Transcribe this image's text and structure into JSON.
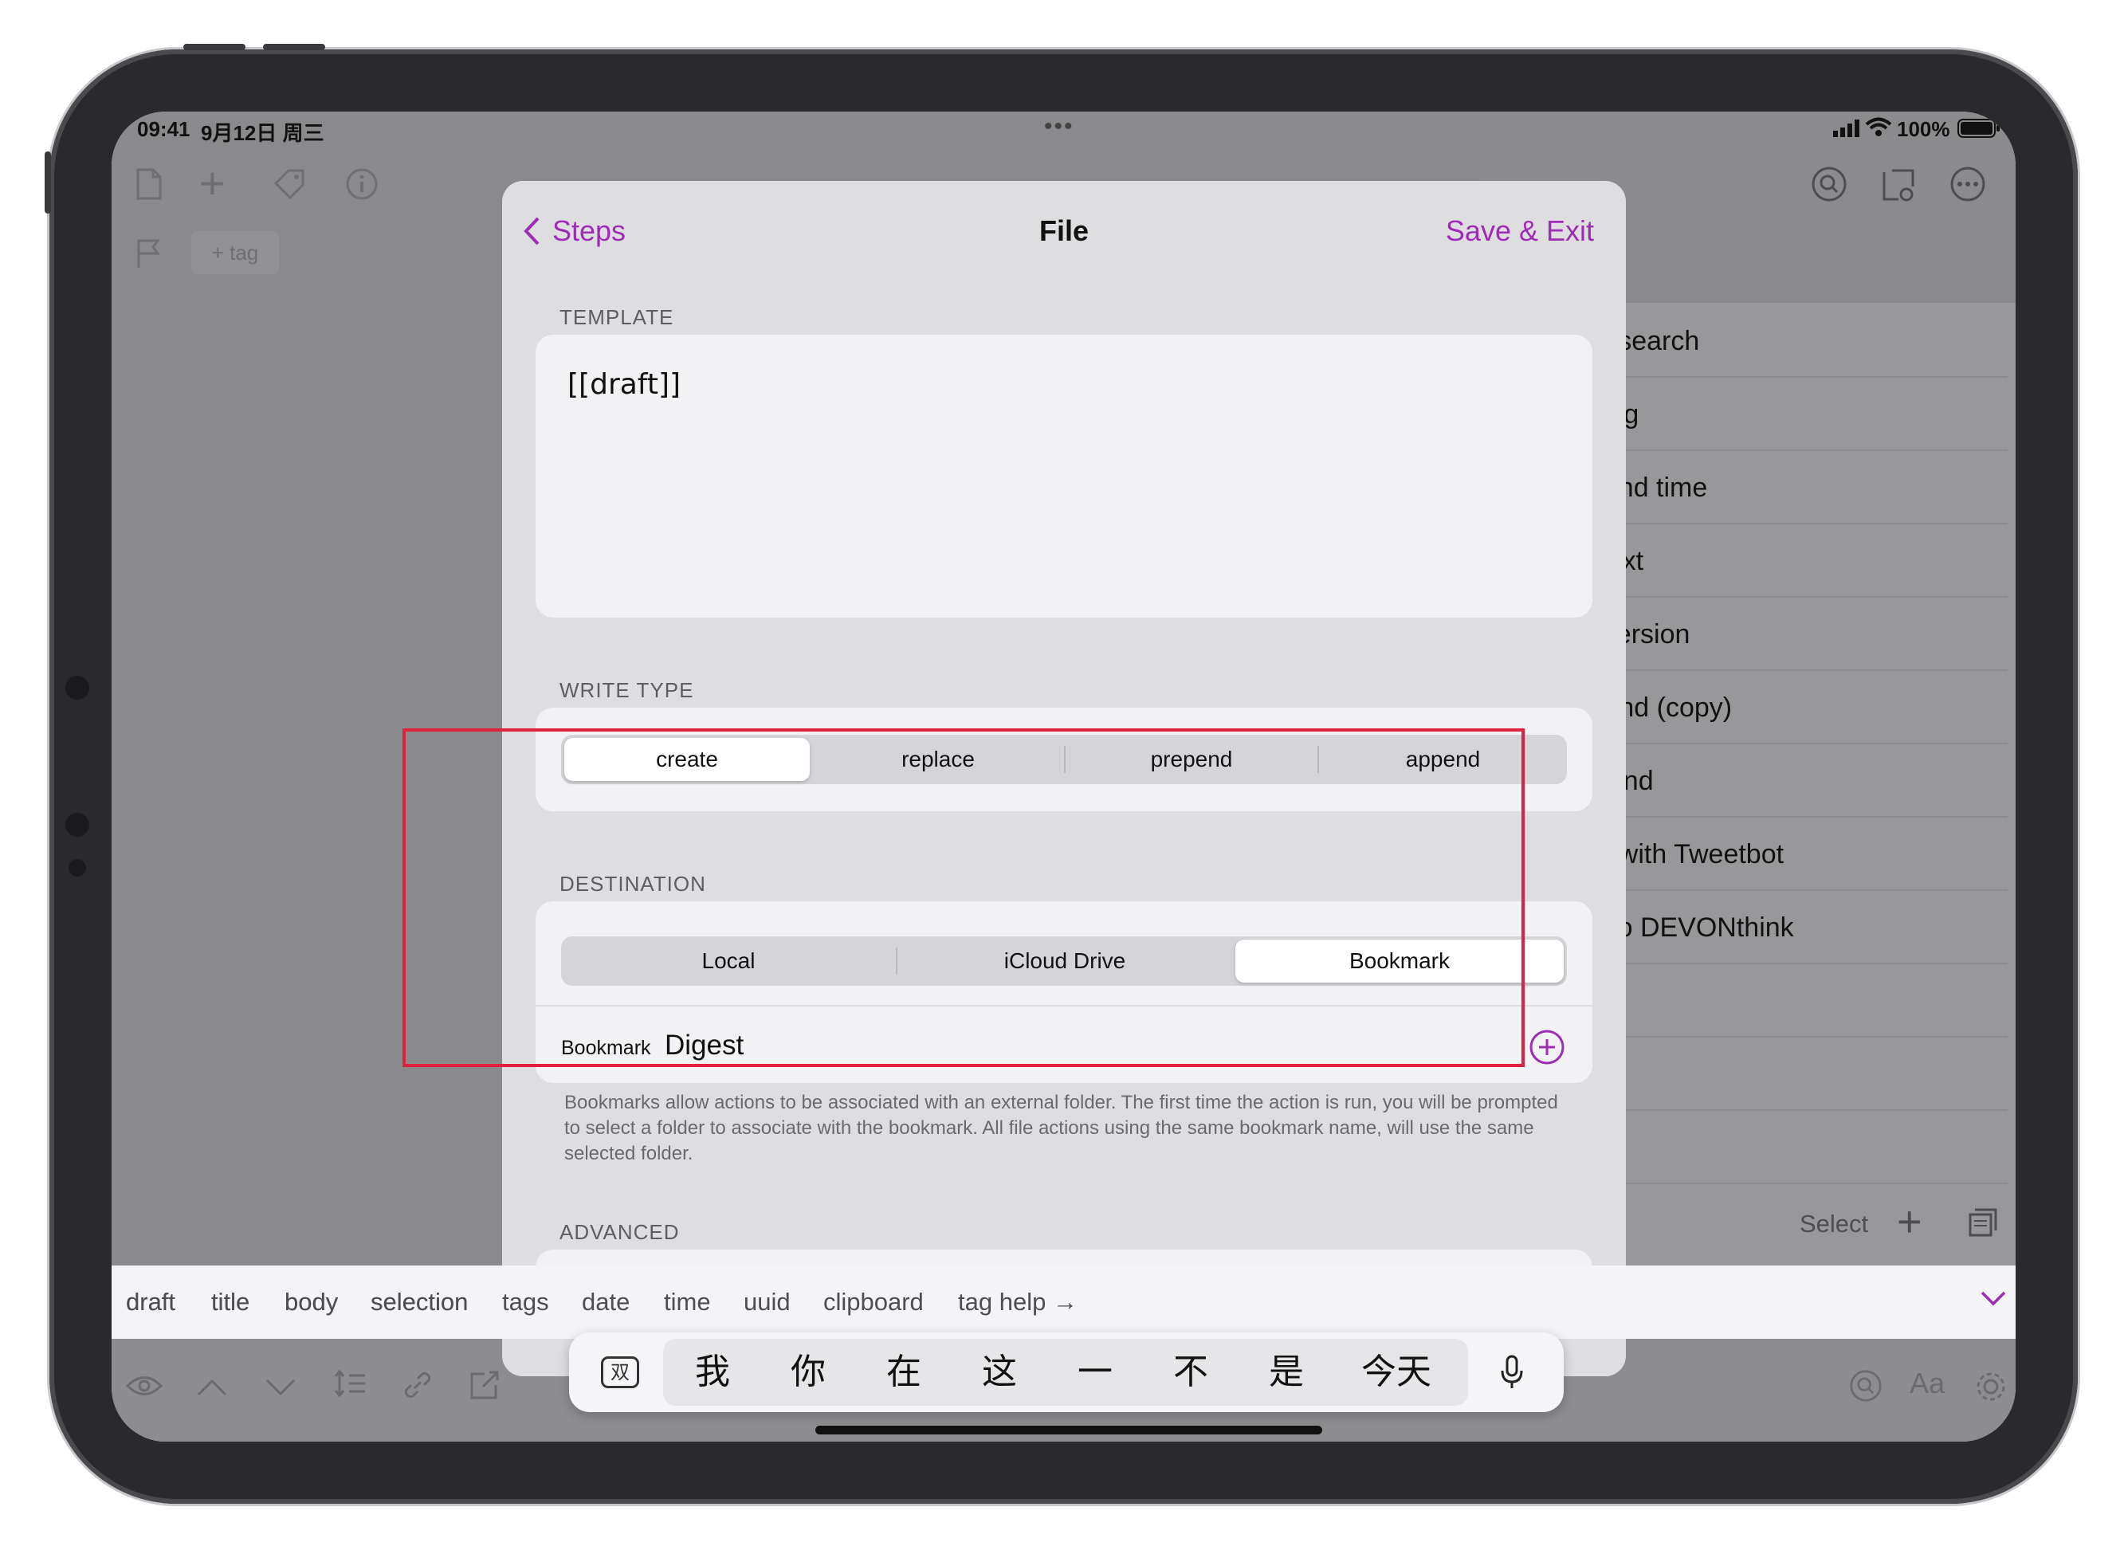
{
  "status_bar": {
    "time": "09:41",
    "date": "9月12日 周三",
    "battery": "100%",
    "dots": "•••"
  },
  "left_toolbar": {
    "tag_button": "+ tag"
  },
  "background_list": [
    "search",
    "g",
    "nd time",
    "xt",
    "ersion",
    "nd (copy)",
    "nd",
    "with Tweetbot",
    "o DEVONthink"
  ],
  "right_footer": {
    "select_label": "Select"
  },
  "modal": {
    "back_label": "Steps",
    "title": "File",
    "save_label": "Save & Exit",
    "template_label": "TEMPLATE",
    "template_value": "[[draft]]",
    "write_type_label": "WRITE TYPE",
    "write_type_options": [
      "create",
      "replace",
      "prepend",
      "append"
    ],
    "write_type_selected": "create",
    "destination_label": "DESTINATION",
    "destination_options": [
      "Local",
      "iCloud Drive",
      "Bookmark"
    ],
    "destination_selected": "Bookmark",
    "bookmark_field_label": "Bookmark",
    "bookmark_value": "Digest",
    "description": "Bookmarks allow actions to be associated with an external folder. The first time the action is run, you will be prompted to select a folder to associate with the bookmark. All file actions using the same bookmark name, will use the same selected folder.",
    "advanced_label": "ADVANCED"
  },
  "tag_bar": [
    "draft",
    "title",
    "body",
    "selection",
    "tags",
    "date",
    "time",
    "uuid",
    "clipboard",
    "tag help →"
  ],
  "bottom_toolbar": {
    "font_label": "Aa"
  },
  "candidates": {
    "switch_key": "双",
    "items": [
      "我",
      "你",
      "在",
      "这",
      "一",
      "不",
      "是",
      "今天"
    ]
  },
  "colors": {
    "accent": "#9c2db4",
    "highlight": "#e0203f"
  }
}
